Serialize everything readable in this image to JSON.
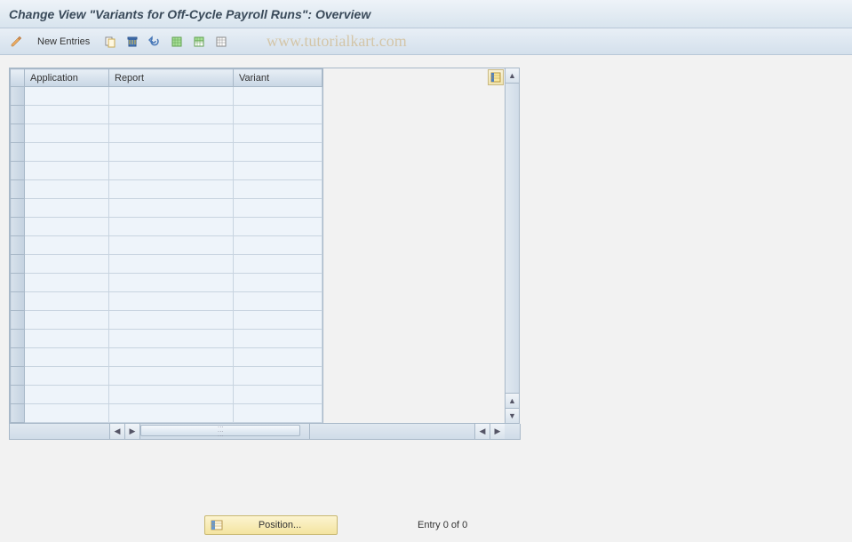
{
  "title": "Change View \"Variants for Off-Cycle Payroll Runs\": Overview",
  "toolbar": {
    "new_entries_label": "New Entries"
  },
  "watermark": "www.tutorialkart.com",
  "table": {
    "columns": [
      "Application",
      "Report",
      "Variant"
    ],
    "row_count": 18
  },
  "footer": {
    "position_label": "Position...",
    "entry_label": "Entry 0 of 0"
  }
}
